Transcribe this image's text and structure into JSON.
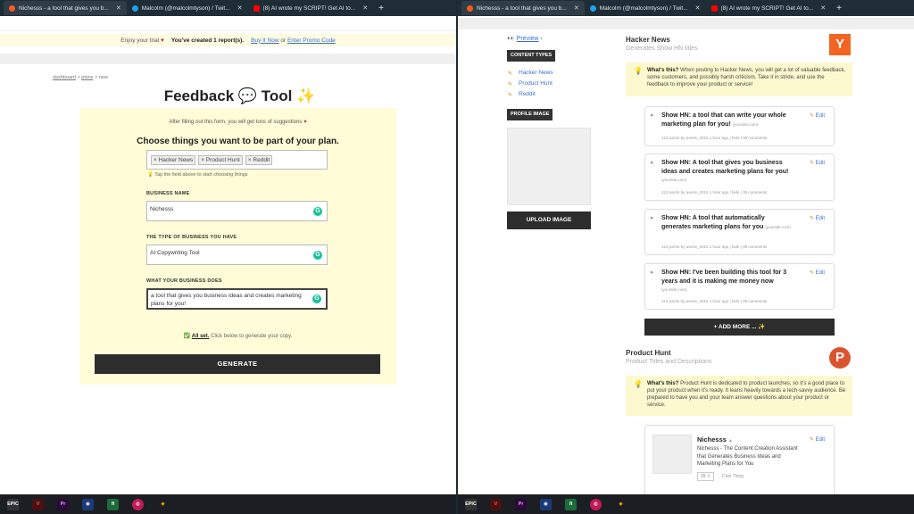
{
  "tabs": [
    {
      "title": "Nichesss - a tool that gives you b...",
      "color": "#ff5a1f"
    },
    {
      "title": "Malcolm (@malcolmtyson) / Twit...",
      "color": "#1da1f2"
    },
    {
      "title": "(8) AI wrote my SCRIPT! Get AI to...",
      "color": "#ff0000"
    }
  ],
  "new_tab_symbol": "+",
  "close_symbol": "✕",
  "trial": {
    "text": "Enjoy your trial",
    "created": "You've created 1 report(s).",
    "buy": "Buy It Now",
    "or": "or",
    "promo": "Enter Promo Code"
  },
  "breadcrumb": {
    "dashboard": "dashboard",
    "sep": ">",
    "plans": "plans",
    "current": "new"
  },
  "form": {
    "title": "Feedback 💬 Tool ✨",
    "hint": "After filling out this form, you will get tons of suggestions",
    "choose_heading": "Choose things you want to be part of your plan.",
    "tags": [
      "× Hacker News",
      "× Product Hunt",
      "× Reddit"
    ],
    "tap_hint": "Tap the field above to start choosing things",
    "business_name_label": "BUSINESS NAME",
    "business_name_value": "Nichesss",
    "business_type_label": "THE TYPE OF BUSINESS YOU HAVE",
    "business_type_value": "AI Copywriting Tool",
    "business_does_label": "WHAT YOUR BUSINESS DOES",
    "business_does_value": "a tool that gives you business ideas and creates marketing plans for you!",
    "all_set": "All set.",
    "all_set_rest": "Click below to generate your copy.",
    "generate": "GENERATE"
  },
  "sidebar": {
    "preview": "Preview",
    "content_types": "CONTENT TYPES",
    "links": [
      "Hacker News",
      "Product Hunt",
      "Reddit"
    ],
    "profile_image": "PROFILE IMAGE",
    "upload": "UPLOAD IMAGE"
  },
  "hacker_news": {
    "heading": "Hacker News",
    "sub": "Generates Show HN titles",
    "logo": "Y",
    "what_label": "What's this?",
    "what_text": "When posting to Hacker News, you will get a lot of valuable feedback, some customers, and possibly harsh criticism. Take it in stride, and use the feedback to improve your product or service!",
    "items": [
      {
        "title": "Show HN: a tool that can write your whole marketing plan for you!",
        "source": "(yoursite.com)",
        "meta": "113 points by averie_2015 1 hour ago | hide | 39 comments",
        "edit": "Edit"
      },
      {
        "title": "Show HN: A tool that gives you business ideas and creates marketing plans for you!",
        "source": "(yoursite.com)",
        "meta": "113 points by averie_2015 1 hour ago | hide | 39 comments",
        "edit": "Edit"
      },
      {
        "title": "Show HN: A tool that automatically generates marketing plans for you",
        "source": "(yoursite.com)",
        "meta": "113 points by averie_2015 1 hour ago | hide | 39 comments",
        "edit": "Edit"
      },
      {
        "title": "Show HN: I've been building this tool for 3 years and it is making me money now",
        "source": "(yoursite.com)",
        "meta": "113 points by averie_2015 1 hour ago | hide | 39 comments",
        "edit": "Edit"
      }
    ],
    "add_more": "+ ADD MORE ... ✨"
  },
  "product_hunt": {
    "heading": "Product Hunt",
    "sub": "Product Titles and Descriptions",
    "logo": "P",
    "what_label": "What's this?",
    "what_text": "Product Hunt is dedicated to product launches, so it's a good place to put your product when it's ready. It leans heavily towards a tech-savvy audience. Be prepared to have you and your team answer questions about your product or service.",
    "item": {
      "name": "Nichesss",
      "desc": "Nichesss - The Content Creation Assistant that Generates Business Ideas and Marketing Plans for You",
      "votes": "15 ⇧",
      "tag": "Cool Thing",
      "edit": "Edit"
    }
  },
  "taskbar": [
    "EPIC",
    "V",
    "Pr",
    "◉",
    "fi",
    "◍",
    "◆"
  ]
}
